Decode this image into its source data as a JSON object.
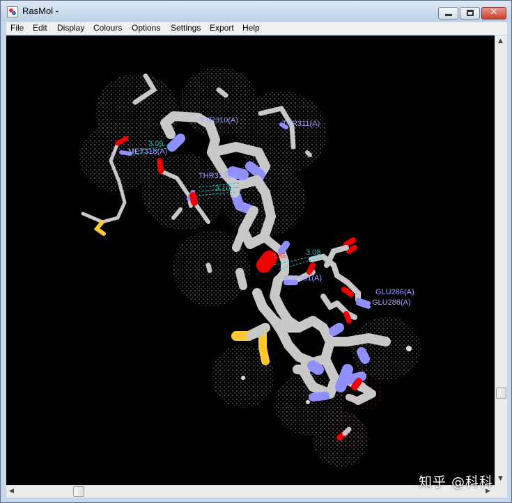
{
  "window": {
    "title": "RasMol -"
  },
  "menu": [
    "File",
    "Edit",
    "Display",
    "Colours",
    "Options",
    "Settings",
    "Export",
    "Help"
  ],
  "labels": {
    "tyr": "TYR310(A)",
    "tyr_b": "TYR311(A)",
    "met": "MET318(A)",
    "thr": "THR315(A)",
    "dist_met": "3.09",
    "dist_thr": "3.10",
    "dist_asp": "3.08",
    "lig": "LIG",
    "asp": "ASP381(A)",
    "glu1": "GLU286(A)",
    "glu2": "GLU286(A)"
  },
  "watermark": "知乎 @科科",
  "colors": {
    "carbon": "#c8c8c8",
    "nitrogen": "#8f8fff",
    "oxygen": "#f00000",
    "sulfur": "#ffc832",
    "hbond": "#00c8c8",
    "label": "#a0a0ff",
    "ligand_label": "#ff3030"
  }
}
